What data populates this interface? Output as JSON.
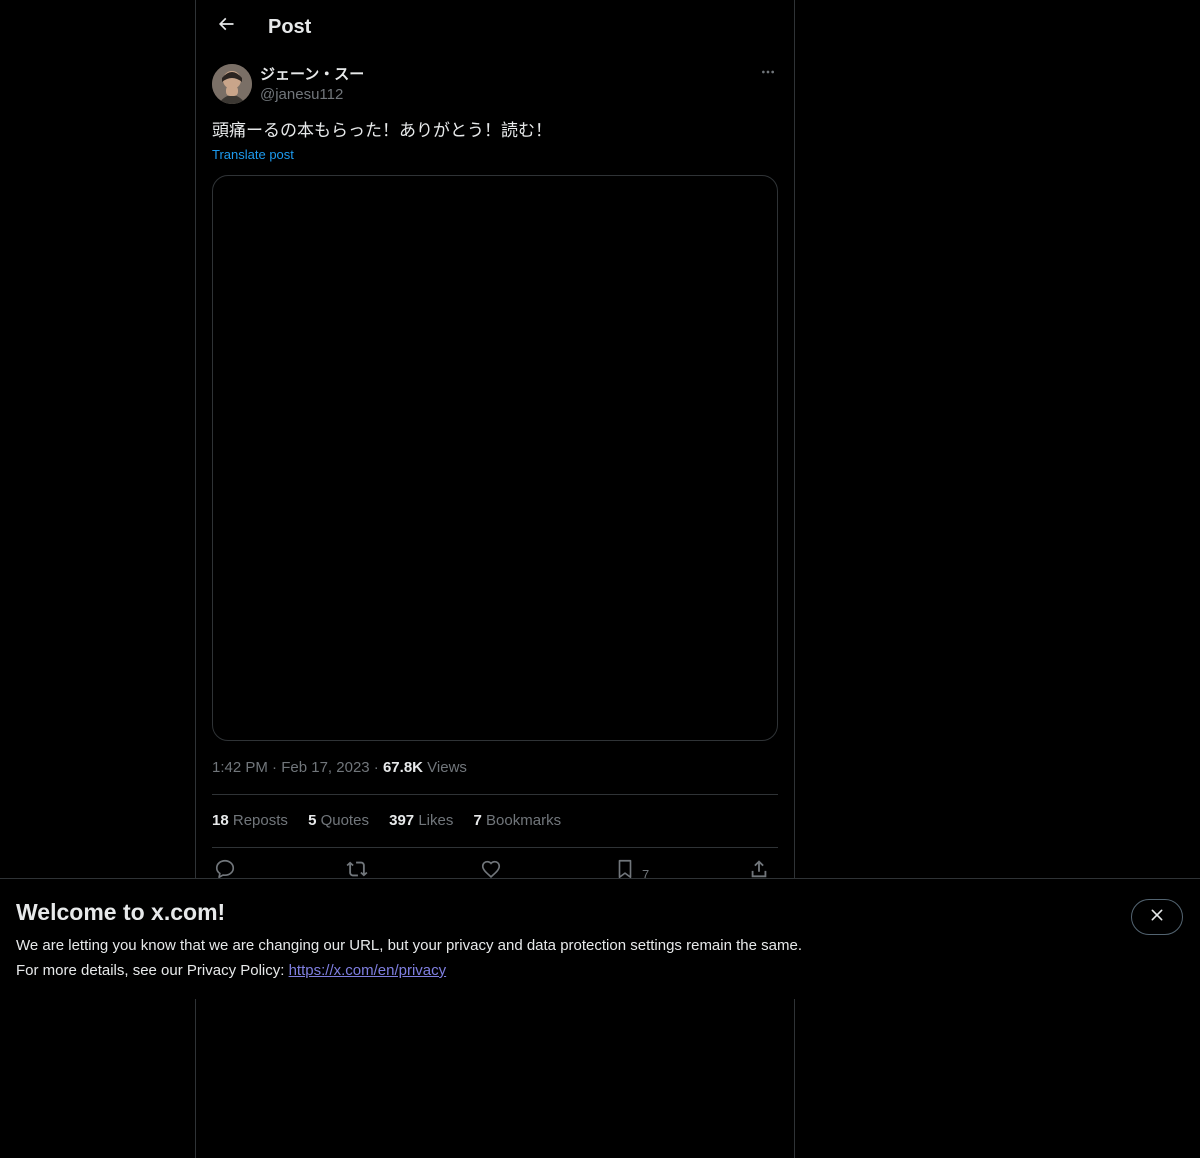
{
  "header": {
    "title": "Post",
    "back_icon": "arrow-left-icon"
  },
  "post": {
    "author": {
      "display_name": "ジェーン・スー",
      "handle": "@janesu112"
    },
    "text": "頭痛ーるの本もらった！ありがとう！読む！",
    "translate_label": "Translate post",
    "time": "1:42 PM",
    "date": "Feb 17, 2023",
    "views_count": "67.8K",
    "views_label": "Views",
    "stats": {
      "reposts_count": "18",
      "reposts_label": "Reposts",
      "quotes_count": "5",
      "quotes_label": "Quotes",
      "likes_count": "397",
      "likes_label": "Likes",
      "bookmarks_count": "7",
      "bookmarks_label": "Bookmarks"
    },
    "actions": {
      "reply_icon": "reply-icon",
      "repost_icon": "repost-icon",
      "like_icon": "heart-icon",
      "bookmark_icon": "bookmark-icon",
      "bookmark_count": "7",
      "share_icon": "share-icon"
    }
  },
  "banner": {
    "title": "Welcome to x.com!",
    "line1": "We are letting you know that we are changing our URL, but your privacy and data protection settings remain the same.",
    "line2_prefix": "For more details, see our Privacy Policy: ",
    "link_text": "https://x.com/en/privacy",
    "close_icon": "close-icon"
  },
  "colors": {
    "background": "#000000",
    "text_primary": "#e7e9ea",
    "text_secondary": "#71767b",
    "accent": "#1d9bf0",
    "border": "#2f3336",
    "link": "#7f7fe0"
  }
}
